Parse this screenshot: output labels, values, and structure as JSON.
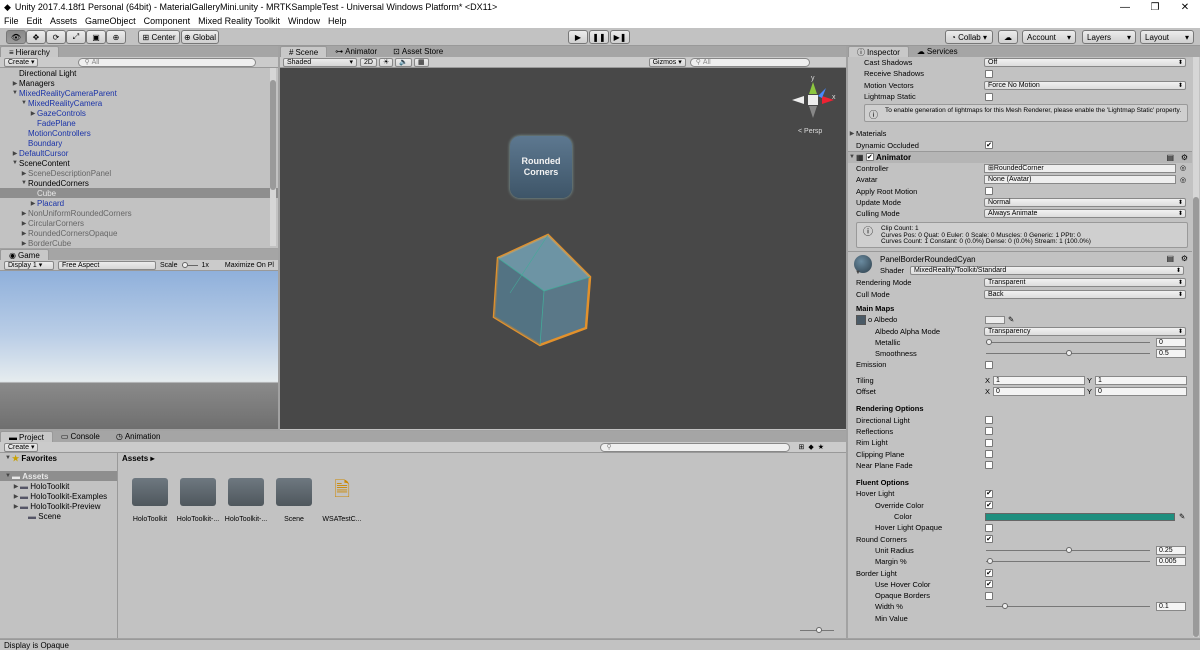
{
  "titlebar": {
    "title": "Unity 2017.4.18f1 Personal (64bit) - MaterialGalleryMini.unity - MRTKSampleTest - Universal Windows Platform* <DX11>"
  },
  "menu": [
    "File",
    "Edit",
    "Assets",
    "GameObject",
    "Component",
    "Mixed Reality Toolkit",
    "Window",
    "Help"
  ],
  "toolbar": {
    "center": "Center",
    "global": "Global",
    "collab": "Collab",
    "account": "Account",
    "layers": "Layers",
    "layout": "Layout"
  },
  "hierarchy": {
    "tab": "Hierarchy",
    "create": "Create",
    "search": "All",
    "items": [
      {
        "label": "Directional Light",
        "indent": 1,
        "arrow": "",
        "color": "black"
      },
      {
        "label": "Managers",
        "indent": 1,
        "arrow": "▶",
        "color": "black"
      },
      {
        "label": "MixedRealityCameraParent",
        "indent": 1,
        "arrow": "▼",
        "color": "blue"
      },
      {
        "label": "MixedRealityCamera",
        "indent": 2,
        "arrow": "▼",
        "color": "blue"
      },
      {
        "label": "GazeControls",
        "indent": 3,
        "arrow": "▶",
        "color": "blue"
      },
      {
        "label": "FadePlane",
        "indent": 3,
        "arrow": "",
        "color": "blue"
      },
      {
        "label": "MotionControllers",
        "indent": 2,
        "arrow": "",
        "color": "blue"
      },
      {
        "label": "Boundary",
        "indent": 2,
        "arrow": "",
        "color": "blue"
      },
      {
        "label": "DefaultCursor",
        "indent": 1,
        "arrow": "▶",
        "color": "blue"
      },
      {
        "label": "SceneContent",
        "indent": 1,
        "arrow": "▼",
        "color": "black"
      },
      {
        "label": "SceneDescriptionPanel",
        "indent": 2,
        "arrow": "▶",
        "color": "grey"
      },
      {
        "label": "RoundedCorners",
        "indent": 2,
        "arrow": "▼",
        "color": "black"
      },
      {
        "label": "Cube",
        "indent": 3,
        "arrow": "",
        "color": "sel"
      },
      {
        "label": "Placard",
        "indent": 3,
        "arrow": "▶",
        "color": "blue"
      },
      {
        "label": "NonUniformRoundedCorners",
        "indent": 2,
        "arrow": "▶",
        "color": "grey"
      },
      {
        "label": "CircularCorners",
        "indent": 2,
        "arrow": "▶",
        "color": "grey"
      },
      {
        "label": "RoundedCornersOpaque",
        "indent": 2,
        "arrow": "▶",
        "color": "grey"
      },
      {
        "label": "BorderCube",
        "indent": 2,
        "arrow": "▶",
        "color": "grey"
      }
    ]
  },
  "game": {
    "tab": "Game",
    "display": "Display 1",
    "aspect": "Free Aspect",
    "scale_label": "Scale",
    "scale_val": "1x",
    "maximize": "Maximize On Pl"
  },
  "scene": {
    "tabs": [
      "Scene",
      "Animator",
      "Asset Store"
    ],
    "shaded": "Shaded",
    "mode2d": "2D",
    "gizmos": "Gizmos",
    "search": "All",
    "persp": "< Persp",
    "gizmo_y": "y",
    "gizmo_x": "x",
    "placard_line1": "Rounded",
    "placard_line2": "Corners"
  },
  "project": {
    "tabs": [
      "Project",
      "Console",
      "Animation"
    ],
    "create": "Create",
    "favorites": "Favorites",
    "assets_label": "Assets",
    "breadcrumb": "Assets ▸",
    "tree": [
      "HoloToolkit",
      "HoloToolkit-Examples",
      "HoloToolkit-Preview",
      "Scene"
    ],
    "files": [
      "HoloToolkit",
      "HoloToolkit-...",
      "HoloToolkit-...",
      "Scene",
      "WSATestC..."
    ]
  },
  "inspector": {
    "tabs": [
      "Inspector",
      "Services"
    ],
    "mesh_rows": [
      {
        "label": "Cast Shadows",
        "type": "dd",
        "value": "Off"
      },
      {
        "label": "Receive Shadows",
        "type": "cb",
        "checked": false
      },
      {
        "label": "Motion Vectors",
        "type": "dd",
        "value": "Force No Motion"
      },
      {
        "label": "Lightmap Static",
        "type": "cb",
        "checked": false
      }
    ],
    "lightmap_note": "To enable generation of lightmaps for this Mesh Renderer, please enable the 'Lightmap Static' property.",
    "materials": "Materials",
    "dynamic_occluded": "Dynamic Occluded",
    "animator": {
      "title": "Animator",
      "rows": [
        {
          "label": "Controller",
          "value": "RoundedCorner"
        },
        {
          "label": "Avatar",
          "value": "None (Avatar)"
        },
        {
          "label": "Apply Root Motion",
          "checked": false
        },
        {
          "label": "Update Mode",
          "value": "Normal"
        },
        {
          "label": "Culling Mode",
          "value": "Always Animate"
        }
      ],
      "info": [
        "Clip Count: 1",
        "Curves Pos: 0 Quat: 0 Euler: 0 Scale: 0 Muscles: 0 Generic: 1 PPtr: 0",
        "Curves Count: 1 Constant: 0 (0.0%) Dense: 0 (0.0%) Stream: 1 (100.0%)"
      ]
    },
    "material": {
      "name": "PanelBorderRoundedCyan",
      "shader_label": "Shader",
      "shader": "MixedReality/Toolkit/Standard"
    },
    "rendering_mode": {
      "label": "Rendering Mode",
      "value": "Transparent"
    },
    "cull_mode": {
      "label": "Cull Mode",
      "value": "Back"
    },
    "main_maps": "Main Maps",
    "albedo": "Albedo",
    "albedo_alpha": {
      "label": "Albedo Alpha Mode",
      "value": "Transparency"
    },
    "metallic": {
      "label": "Metallic",
      "value": "0",
      "fraction": 0
    },
    "smoothness": {
      "label": "Smoothness",
      "value": "0.5",
      "fraction": 0.5
    },
    "emission": "Emission",
    "tiling": {
      "label": "Tiling",
      "x": "1",
      "y": "1"
    },
    "offset": {
      "label": "Offset",
      "x": "0",
      "y": "0"
    },
    "x_label": "X",
    "y_label": "Y",
    "rendering_options": {
      "title": "Rendering Options",
      "items": [
        "Directional Light",
        "Reflections",
        "Rim Light",
        "Clipping Plane",
        "Near Plane Fade"
      ]
    },
    "fluent": {
      "title": "Fluent Options",
      "hover_light": "Hover Light",
      "override_color": "Override Color",
      "color": "Color",
      "color_hex": "#1e8f7f",
      "hover_opaque": "Hover Light Opaque",
      "round_corners": "Round Corners",
      "unit_radius": {
        "label": "Unit Radius",
        "value": "0.25",
        "fraction": 0.5
      },
      "margin": {
        "label": "Margin %",
        "value": "0.005",
        "fraction": 0.005
      },
      "border_light": "Border Light",
      "use_hover_color": "Use Hover Color",
      "opaque_borders": "Opaque Borders",
      "width": {
        "label": "Width %",
        "value": "0.1",
        "fraction": 0.1
      },
      "min_value": "Min Value"
    }
  },
  "status": "Display is Opaque"
}
